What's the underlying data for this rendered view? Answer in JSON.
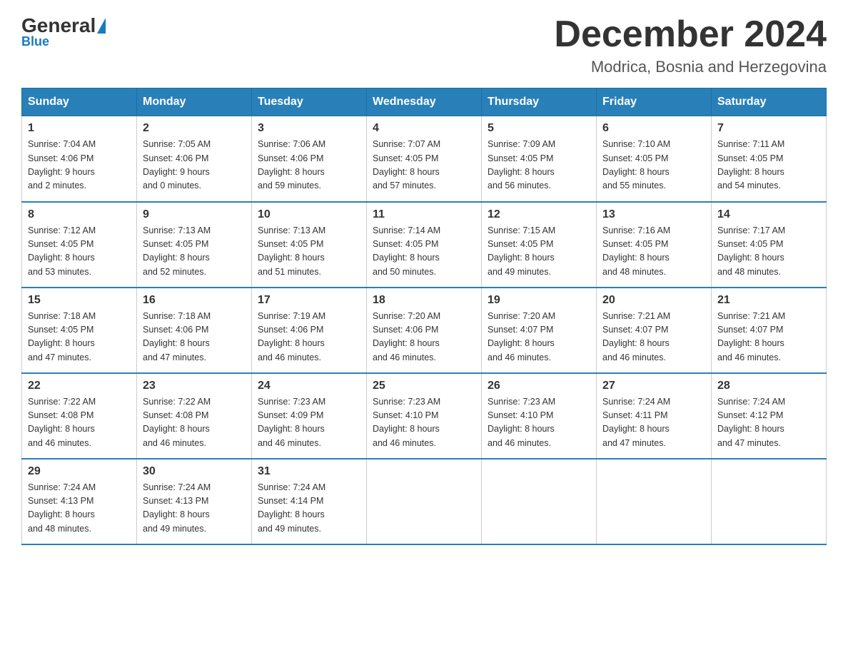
{
  "logo": {
    "general": "General",
    "blue": "Blue"
  },
  "title": "December 2024",
  "location": "Modrica, Bosnia and Herzegovina",
  "days_header": [
    "Sunday",
    "Monday",
    "Tuesday",
    "Wednesday",
    "Thursday",
    "Friday",
    "Saturday"
  ],
  "weeks": [
    [
      {
        "day": "1",
        "sunrise": "7:04 AM",
        "sunset": "4:06 PM",
        "daylight": "9 hours and 2 minutes."
      },
      {
        "day": "2",
        "sunrise": "7:05 AM",
        "sunset": "4:06 PM",
        "daylight": "9 hours and 0 minutes."
      },
      {
        "day": "3",
        "sunrise": "7:06 AM",
        "sunset": "4:06 PM",
        "daylight": "8 hours and 59 minutes."
      },
      {
        "day": "4",
        "sunrise": "7:07 AM",
        "sunset": "4:05 PM",
        "daylight": "8 hours and 57 minutes."
      },
      {
        "day": "5",
        "sunrise": "7:09 AM",
        "sunset": "4:05 PM",
        "daylight": "8 hours and 56 minutes."
      },
      {
        "day": "6",
        "sunrise": "7:10 AM",
        "sunset": "4:05 PM",
        "daylight": "8 hours and 55 minutes."
      },
      {
        "day": "7",
        "sunrise": "7:11 AM",
        "sunset": "4:05 PM",
        "daylight": "8 hours and 54 minutes."
      }
    ],
    [
      {
        "day": "8",
        "sunrise": "7:12 AM",
        "sunset": "4:05 PM",
        "daylight": "8 hours and 53 minutes."
      },
      {
        "day": "9",
        "sunrise": "7:13 AM",
        "sunset": "4:05 PM",
        "daylight": "8 hours and 52 minutes."
      },
      {
        "day": "10",
        "sunrise": "7:13 AM",
        "sunset": "4:05 PM",
        "daylight": "8 hours and 51 minutes."
      },
      {
        "day": "11",
        "sunrise": "7:14 AM",
        "sunset": "4:05 PM",
        "daylight": "8 hours and 50 minutes."
      },
      {
        "day": "12",
        "sunrise": "7:15 AM",
        "sunset": "4:05 PM",
        "daylight": "8 hours and 49 minutes."
      },
      {
        "day": "13",
        "sunrise": "7:16 AM",
        "sunset": "4:05 PM",
        "daylight": "8 hours and 48 minutes."
      },
      {
        "day": "14",
        "sunrise": "7:17 AM",
        "sunset": "4:05 PM",
        "daylight": "8 hours and 48 minutes."
      }
    ],
    [
      {
        "day": "15",
        "sunrise": "7:18 AM",
        "sunset": "4:05 PM",
        "daylight": "8 hours and 47 minutes."
      },
      {
        "day": "16",
        "sunrise": "7:18 AM",
        "sunset": "4:06 PM",
        "daylight": "8 hours and 47 minutes."
      },
      {
        "day": "17",
        "sunrise": "7:19 AM",
        "sunset": "4:06 PM",
        "daylight": "8 hours and 46 minutes."
      },
      {
        "day": "18",
        "sunrise": "7:20 AM",
        "sunset": "4:06 PM",
        "daylight": "8 hours and 46 minutes."
      },
      {
        "day": "19",
        "sunrise": "7:20 AM",
        "sunset": "4:07 PM",
        "daylight": "8 hours and 46 minutes."
      },
      {
        "day": "20",
        "sunrise": "7:21 AM",
        "sunset": "4:07 PM",
        "daylight": "8 hours and 46 minutes."
      },
      {
        "day": "21",
        "sunrise": "7:21 AM",
        "sunset": "4:07 PM",
        "daylight": "8 hours and 46 minutes."
      }
    ],
    [
      {
        "day": "22",
        "sunrise": "7:22 AM",
        "sunset": "4:08 PM",
        "daylight": "8 hours and 46 minutes."
      },
      {
        "day": "23",
        "sunrise": "7:22 AM",
        "sunset": "4:08 PM",
        "daylight": "8 hours and 46 minutes."
      },
      {
        "day": "24",
        "sunrise": "7:23 AM",
        "sunset": "4:09 PM",
        "daylight": "8 hours and 46 minutes."
      },
      {
        "day": "25",
        "sunrise": "7:23 AM",
        "sunset": "4:10 PM",
        "daylight": "8 hours and 46 minutes."
      },
      {
        "day": "26",
        "sunrise": "7:23 AM",
        "sunset": "4:10 PM",
        "daylight": "8 hours and 46 minutes."
      },
      {
        "day": "27",
        "sunrise": "7:24 AM",
        "sunset": "4:11 PM",
        "daylight": "8 hours and 47 minutes."
      },
      {
        "day": "28",
        "sunrise": "7:24 AM",
        "sunset": "4:12 PM",
        "daylight": "8 hours and 47 minutes."
      }
    ],
    [
      {
        "day": "29",
        "sunrise": "7:24 AM",
        "sunset": "4:13 PM",
        "daylight": "8 hours and 48 minutes."
      },
      {
        "day": "30",
        "sunrise": "7:24 AM",
        "sunset": "4:13 PM",
        "daylight": "8 hours and 49 minutes."
      },
      {
        "day": "31",
        "sunrise": "7:24 AM",
        "sunset": "4:14 PM",
        "daylight": "8 hours and 49 minutes."
      },
      null,
      null,
      null,
      null
    ]
  ],
  "labels": {
    "sunrise": "Sunrise:",
    "sunset": "Sunset:",
    "daylight": "Daylight:"
  }
}
